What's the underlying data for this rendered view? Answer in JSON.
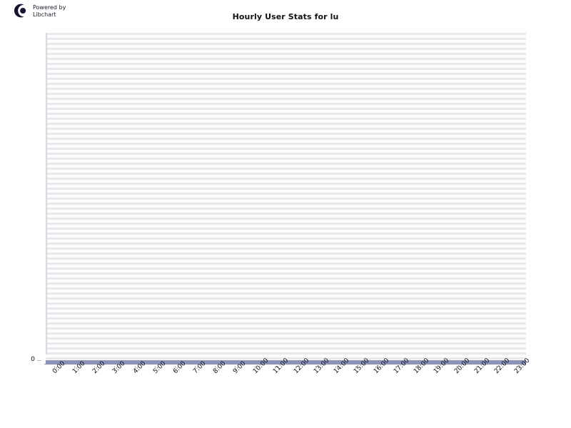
{
  "branding": {
    "logo_icon": "libchart-logo-icon",
    "line1": "Powered by",
    "line2": "Libchart"
  },
  "chart_data": {
    "type": "bar",
    "title": "Hourly User Stats for lu",
    "xlabel": "",
    "ylabel": "",
    "categories": [
      "0:00",
      "1:00",
      "2:00",
      "3:00",
      "4:00",
      "5:00",
      "6:00",
      "7:00",
      "8:00",
      "9:00",
      "10:00",
      "11:00",
      "12:00",
      "13:00",
      "14:00",
      "15:00",
      "16:00",
      "17:00",
      "18:00",
      "19:00",
      "20:00",
      "21:00",
      "22:00",
      "23:00"
    ],
    "values": [
      0,
      0,
      0,
      0,
      0,
      0,
      0,
      0,
      0,
      0,
      0,
      0,
      0,
      0,
      0,
      0,
      0,
      0,
      0,
      0,
      0,
      0,
      0,
      0
    ],
    "y_ticks": [
      "0"
    ],
    "ylim": [
      0,
      0
    ],
    "grid": true,
    "legend": false,
    "series_color": "#8d92b8",
    "plot_background": "#ffffff",
    "gridline_color": "#e9e9ee",
    "axis_color": "#d9d9e0",
    "text_color": "#111118"
  }
}
